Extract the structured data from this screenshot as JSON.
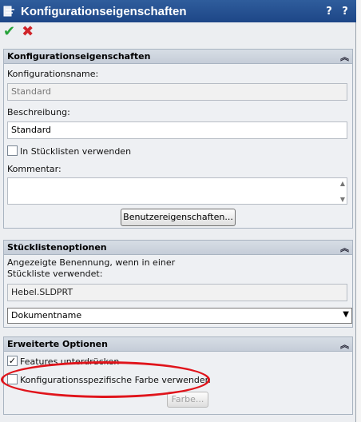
{
  "window": {
    "title": "Konfigurationseigenschaften",
    "help_label": "?",
    "pin_label": "?"
  },
  "toolbar": {
    "ok_label": "✔",
    "cancel_label": "✖"
  },
  "config_group": {
    "header": "Konfigurationseigenschaften",
    "name_label": "Konfigurationsname:",
    "name_value": "Standard",
    "description_label": "Beschreibung:",
    "description_value": "Standard",
    "bom_checkbox_label": "In Stücklisten verwenden",
    "comment_label": "Kommentar:",
    "user_props_button": "Benutzereigenschaften..."
  },
  "bom_group": {
    "header": "Stücklistenoptionen",
    "display_label_line1": "Angezeigte Benennung, wenn in einer",
    "display_label_line2": "Stückliste verwendet:",
    "display_value": "Hebel.SLDPRT",
    "select_value": "Dokumentname"
  },
  "advanced_group": {
    "header": "Erweiterte Optionen",
    "suppress_features_label": "Features unterdrücken",
    "suppress_features_checked": true,
    "config_color_label": "Konfigurationsspezifische Farbe verwenden",
    "config_color_checked": false,
    "color_button": "Farbe..."
  },
  "colors": {
    "titlebar": "#1d4687",
    "ok": "#27a33a",
    "cancel": "#d0242a",
    "annotation": "#e0141b"
  }
}
